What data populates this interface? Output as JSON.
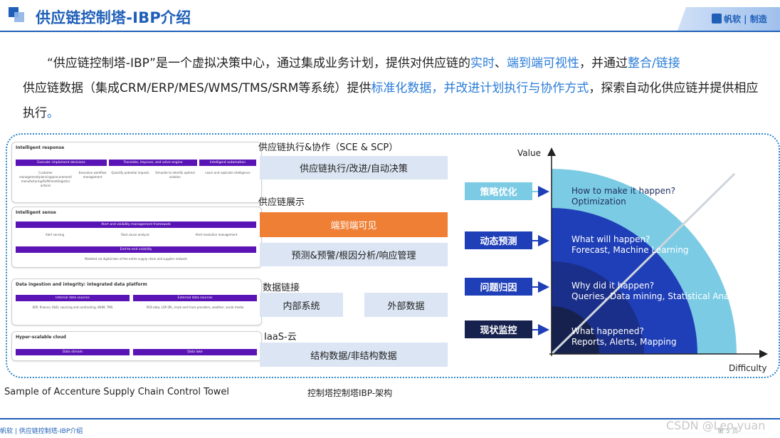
{
  "header": {
    "title": "供应链控制塔-IBP介绍",
    "brand": "帆软 | 制造"
  },
  "intro": {
    "p1": "“供应链控制塔-IBP”是一个虚拟决策中心，通过集成业务计划，提供对供应链的",
    "h1": "实时",
    "p2": "、",
    "h2": "端到端可视性",
    "p3": "，并通过",
    "h3": "整合/链接",
    "p4": "供应链数据（集成CRM/ERP/MES/WMS/TMS/SRM等系统）提供",
    "h4": "标准化数据",
    "p5": "，",
    "h5": "并改进计划执行与协作方式",
    "p6": "，探索自动化供应链并提供相应执行",
    "p7": "。"
  },
  "sample": {
    "card1": {
      "title": "Intelligent response",
      "bars": [
        "Execute: implement decisions",
        "Translate, improve, and solve engine",
        "Intelligent automation"
      ],
      "subs": [
        "Customer management/planning/procurement/ manufacturing/fulfillment/logistics actions",
        "Execution workflow management",
        "Quantify potential impacts",
        "Simulate to identify optimal solution",
        "Learn and replicate intelligence"
      ]
    },
    "card2": {
      "title": "Intelligent sense",
      "bar1": "Alert and visibility management framework",
      "subs": [
        "Alert sensing",
        "Root cause analysis",
        "Alert resolution management"
      ],
      "bar2": "End-to-end visibility",
      "sub2": "Modeled via digital twin of the entire supply chain and supplier network"
    },
    "card3": {
      "title": "Data ingestion and integrity: integrated data platform",
      "bars": [
        "Internal data sources",
        "External data sources"
      ],
      "subs": [
        "ERP, finance, R&D, sourcing and contracting, WHM, TMS",
        "POS data, LSP-3PL, track and trace providers, weather, social media"
      ]
    },
    "card4": {
      "title": "Hyper-scalable cloud",
      "bars": [
        "Data stream",
        "Data lake"
      ]
    }
  },
  "architecture": {
    "sec1": "供应链执行&协作（SCE & SCP）",
    "box1": "供应链执行/改进/自动决策",
    "sec2": "供应链展示",
    "box2": "端到端可见",
    "box3": "预测&预警/根因分析/响应管理",
    "sec3": "数据链接",
    "box4": "内部系统",
    "box5": "外部数据",
    "sec4": "IaaS-云",
    "box6": "结构数据/非结构数据"
  },
  "captions": {
    "left": "Sample of Accenture Supply Chain Control Towel",
    "middle": "控制塔控制塔IBP-架构"
  },
  "maturity": {
    "y_label": "Value",
    "x_label": "Difficulty",
    "levels": [
      {
        "button": "策略优化",
        "line1": "How to make it happen?",
        "line2": "Optimization",
        "color": "#7ccbe4"
      },
      {
        "button": "动态预测",
        "line1": "What will happen?",
        "line2": "Forecast, Machine Learning",
        "color": "#1f3fb8"
      },
      {
        "button": "问题归因",
        "line1": "Why did it happen?",
        "line2": "Queries, Data mining, Statistical Analysis",
        "color": "#1a2f8a"
      },
      {
        "button": "现状监控",
        "line1": "What happened?",
        "line2": "Reports, Alerts, Mapping",
        "color": "#16214e"
      }
    ]
  },
  "footer": {
    "text": "帆软 | 供应链控制塔-IBP介绍",
    "page": "第 5 页",
    "watermark": "CSDN @Leo.yuan"
  }
}
